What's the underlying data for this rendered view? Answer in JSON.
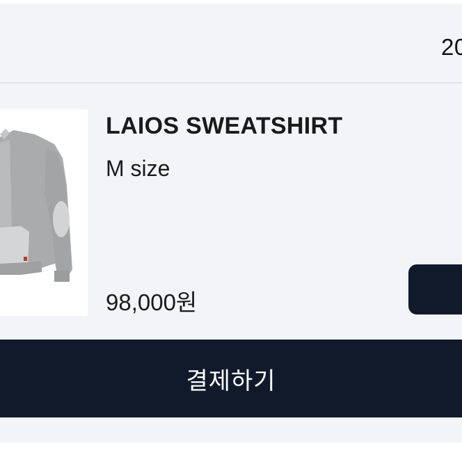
{
  "order": {
    "date_partial": "20"
  },
  "item": {
    "image_icon": "sweatshirt-product-image",
    "name": "LAIOS SWEATSHIRT",
    "option": "M size",
    "price": "98,000원"
  },
  "actions": {
    "pay_label": "결제하기"
  },
  "colors": {
    "background": "#f2f4f7",
    "primary_dark": "#111a2b",
    "text": "#1a1a1a",
    "divider": "#dfe2e7"
  }
}
